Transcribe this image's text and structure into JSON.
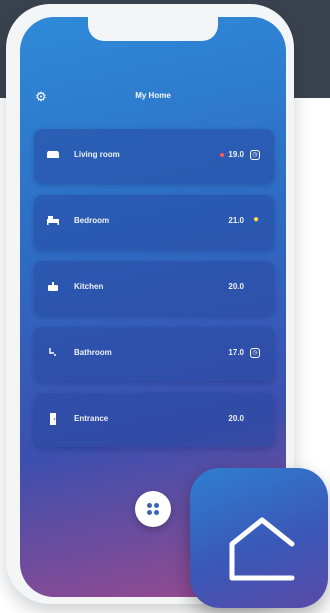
{
  "header": {
    "title": "My Home",
    "settings_icon": "gear-icon"
  },
  "rooms": [
    {
      "name": "Living room",
      "temperature": "19.0",
      "icon": "sofa-icon",
      "status_icon": "timer-icon",
      "heating_dot": true,
      "heating_dot_color": "#ff5a4a"
    },
    {
      "name": "Bedroom",
      "temperature": "21.0",
      "icon": "bed-icon",
      "status_icon": "bulb-icon",
      "bulb_color": "#ffd84a"
    },
    {
      "name": "Kitchen",
      "temperature": "20.0",
      "icon": "pot-icon"
    },
    {
      "name": "Bathroom",
      "temperature": "17.0",
      "icon": "shower-icon",
      "status_icon": "timer-icon"
    },
    {
      "name": "Entrance",
      "temperature": "20.0",
      "icon": "door-icon"
    }
  ],
  "fab": {
    "icon": "grid-dots-icon"
  },
  "app_badge": {
    "icon": "home-icon"
  },
  "colors": {
    "screen_gradient": [
      "#2f8ad8",
      "#2e6cc4",
      "#3d4fae",
      "#9a4a8e"
    ],
    "card": "#2848a0",
    "accent": "#3d63c2",
    "backdrop": "#3a4250"
  }
}
